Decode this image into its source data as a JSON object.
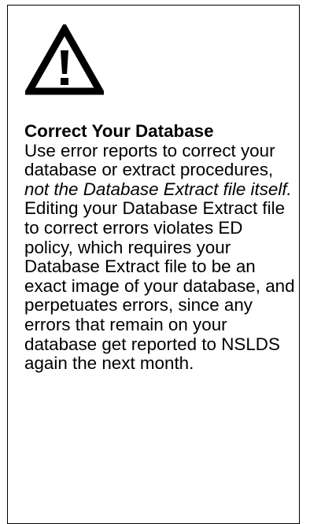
{
  "callout": {
    "icon": "warning-triangle-icon",
    "title": "Correct Your Database",
    "body_intro": "Use error reports to correct your database or extract procedures, ",
    "body_emphasis": "not the Database Extract file itself.",
    "body_rest": " Editing your Database Extract file to correct errors violates ED policy, which requires your Database Extract file to be an exact image of your database, and perpetuates errors, since any errors that remain on your database get reported to NSLDS again the next month."
  }
}
